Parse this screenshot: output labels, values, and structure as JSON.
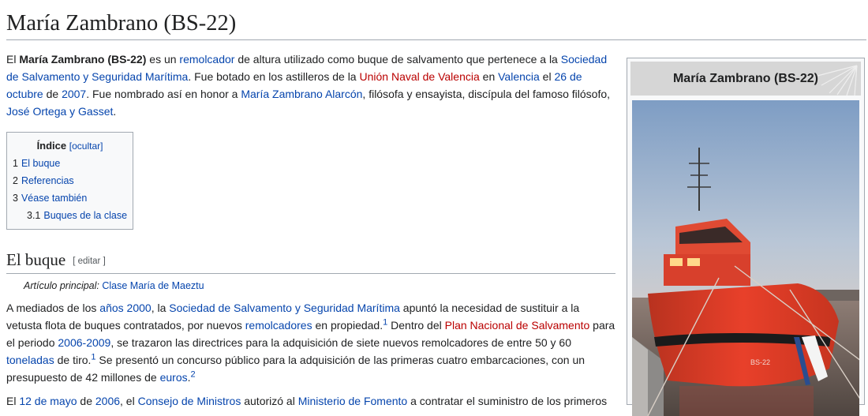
{
  "page": {
    "title": "María Zambrano (BS-22)"
  },
  "intro": {
    "t1": "El ",
    "bold": "María Zambrano (BS-22)",
    "t2": " es un ",
    "l_remolcador": "remolcador",
    "t3": " de altura utilizado como buque de salvamento que pertenece a la ",
    "l_sociedad": "Sociedad de Salvamento y Seguridad Marítima",
    "t4": ". Fue botado en los astilleros de la ",
    "l_union": "Unión Naval de Valencia",
    "t5": " en ",
    "l_valencia": "Valencia",
    "t6": " el ",
    "l_fecha": "26 de octubre",
    "t7": " de ",
    "l_anio": "2007",
    "t8": ". Fue nombrado así en honor a ",
    "l_maria": "María Zambrano Alarcón",
    "t9": ", filósofa y ensayista, discípula del famoso filósofo, ",
    "l_ortega": "José Ortega y Gasset",
    "t10": "."
  },
  "toc": {
    "title": "Índice",
    "hide": "[ocultar]",
    "items": [
      {
        "num": "1",
        "label": "El buque"
      },
      {
        "num": "2",
        "label": "Referencias"
      },
      {
        "num": "3",
        "label": "Véase también"
      },
      {
        "num": "3.1",
        "label": "Buques de la clase"
      }
    ]
  },
  "section1": {
    "heading": "El buque",
    "edit": "[ editar ]",
    "hatnote_label": "Artículo principal:",
    "hatnote_link": "Clase María de Maeztu"
  },
  "para1": {
    "t1": "A mediados de los ",
    "l_anios": "años 2000",
    "t2": ", la ",
    "l_sociedad": "Sociedad de Salvamento y Seguridad Marítima",
    "t3": " apuntó la necesidad de sustituir a la vetusta flota de buques contratados, por nuevos ",
    "l_remolcadores": "remolcadores",
    "t4": " en propiedad.",
    "ref1": "1",
    "t5": " Dentro del ",
    "l_plan": "Plan Nacional de Salvamento",
    "t6": " para el periodo ",
    "l_periodo": "2006-2009",
    "t7": ", se trazaron las directrices para la adquisición de siete nuevos remolcadores de entre 50 y 60 ",
    "l_toneladas": "toneladas",
    "t8": " de tiro.",
    "ref2": "1",
    "t9": " Se presentó un concurso público para la adquisición de las primeras cuatro embarcaciones, con un presupuesto de 42 millones de ",
    "l_euros": "euros",
    "t10": ".",
    "ref3": "2"
  },
  "para2": {
    "t1": "El ",
    "l_fecha": "12 de mayo",
    "t2": " de ",
    "l_anio": "2006",
    "t3": ", el ",
    "l_consejo": "Consejo de Ministros",
    "t4": " autorizó al ",
    "l_ministerio": "Ministerio de Fomento",
    "t5": " a contratar el suministro de los primeros"
  },
  "infobox": {
    "header": "María Zambrano (BS-22)",
    "hull_marking": "BS-22"
  },
  "colors": {
    "link": "#0645ad",
    "redlink": "#ba0000",
    "hull": "#e8402a"
  }
}
